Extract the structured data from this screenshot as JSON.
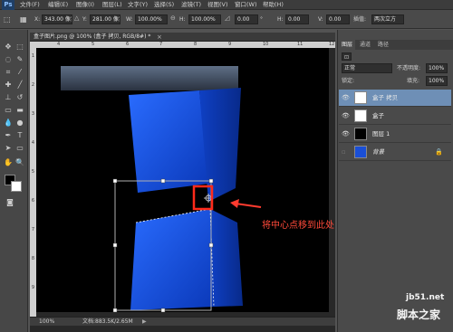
{
  "app": {
    "logo": "Ps"
  },
  "menu": [
    "文件(F)",
    "编辑(E)",
    "图像(I)",
    "图层(L)",
    "文字(Y)",
    "选择(S)",
    "滤镜(T)",
    "视图(V)",
    "窗口(W)",
    "帮助(H)"
  ],
  "options": {
    "x_label": "X:",
    "x_value": "343.00 像素",
    "y_label": "Y:",
    "y_value": "281.00 像素",
    "w_label": "W:",
    "w_value": "100.00%",
    "h_label": "H:",
    "h_value": "100.00%",
    "rot_value": "0.00",
    "hskew_label": "H:",
    "hskew_value": "0.00",
    "vskew_label": "V:",
    "vskew_value": "0.00",
    "interp_value": "两次立方"
  },
  "document": {
    "title": "盒子图片.png @ 100% (盒子 拷贝, RGB/8#) *",
    "ruler_top": [
      "4",
      "5",
      "6",
      "7",
      "8",
      "9",
      "10",
      "11",
      "12"
    ],
    "ruler_left": [
      "1",
      "2",
      "3",
      "4",
      "5",
      "6",
      "7",
      "8",
      "9"
    ],
    "zoom": "100%",
    "doc_size": "文档:883.5K/2.65M"
  },
  "panel": {
    "tabs": [
      "图层",
      "通道",
      "路径"
    ],
    "blend_mode": "正常",
    "opacity_label": "不透明度:",
    "opacity_value": "100%",
    "lock_label": "锁定:",
    "fill_label": "填充:",
    "fill_value": "100%",
    "layers": [
      {
        "name": "盒子 拷贝",
        "selected": true
      },
      {
        "name": "盒子",
        "selected": false
      },
      {
        "name": "图层 1",
        "selected": false
      },
      {
        "name": "背景",
        "selected": false
      }
    ]
  },
  "annotation": {
    "text": "将中心点移到此处",
    "color": "#ff3b2f"
  },
  "watermark": {
    "line1": "jb51.net",
    "line2": "脚本之家"
  },
  "colors": {
    "box_blue": "#1a4fd6",
    "selection": "#6e8fb6"
  }
}
